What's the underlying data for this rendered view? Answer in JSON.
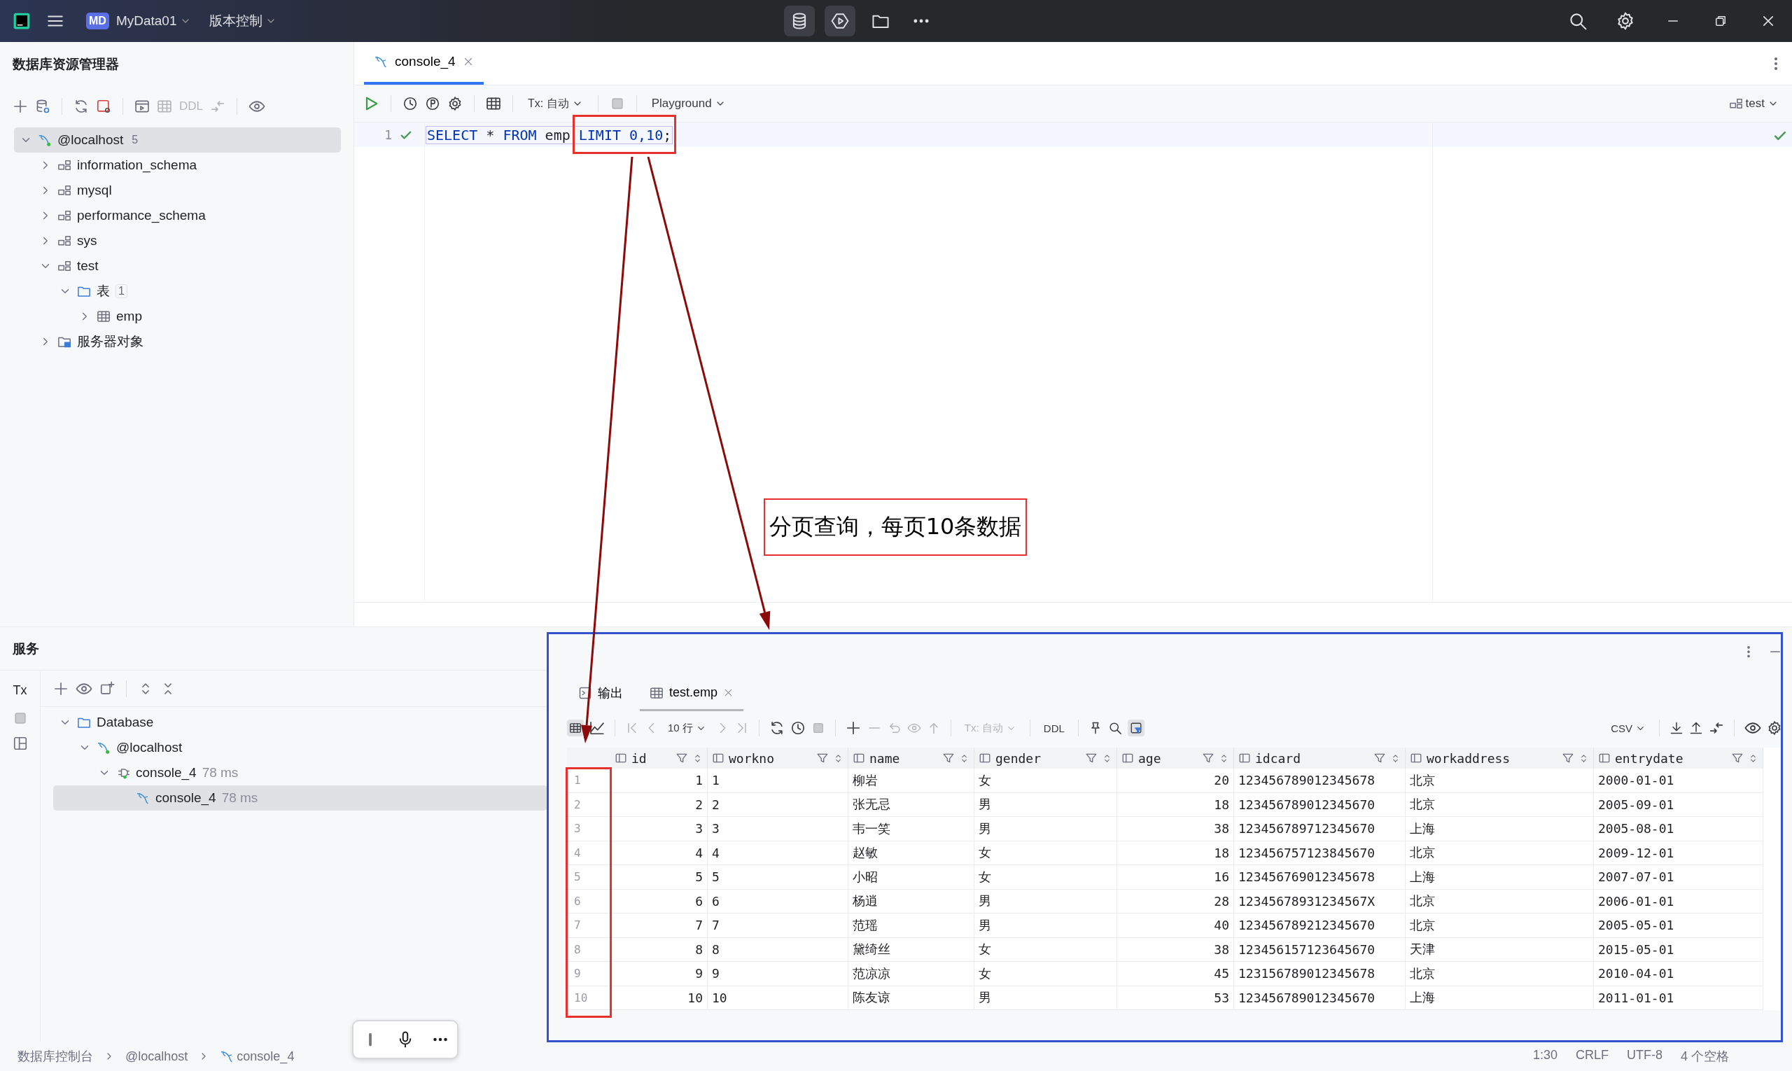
{
  "title_bar": {
    "project_badge": "MD",
    "project": "MyData01",
    "vcs_menu": "版本控制"
  },
  "explorer": {
    "title": "数据库资源管理器",
    "toolbar_label": "DDL",
    "tree": [
      {
        "label": "@localhost",
        "count": "5",
        "kind": "host",
        "expanded": true,
        "selected": true,
        "children": [
          {
            "label": "information_schema",
            "kind": "schema",
            "expanded": false,
            "selected": false
          },
          {
            "label": "mysql",
            "kind": "schema",
            "expanded": false,
            "selected": false
          },
          {
            "label": "performance_schema",
            "kind": "schema",
            "expanded": false,
            "selected": false
          },
          {
            "label": "sys",
            "kind": "schema",
            "expanded": false,
            "selected": false
          },
          {
            "label": "test",
            "kind": "schema",
            "expanded": true,
            "selected": false,
            "children": [
              {
                "label": "表",
                "count": "1",
                "kind": "folder",
                "expanded": true,
                "selected": false,
                "children": [
                  {
                    "label": "emp",
                    "kind": "table",
                    "expanded": false,
                    "selected": false
                  }
                ]
              }
            ]
          },
          {
            "label": "服务器对象",
            "kind": "server-objects",
            "expanded": false,
            "selected": false
          }
        ]
      }
    ]
  },
  "editor": {
    "tabs": [
      {
        "label": "console_4",
        "selected": true
      }
    ],
    "toolbar": {
      "transaction": "Tx: 自动",
      "mode": "Playground",
      "schema": "test"
    },
    "lines": [
      {
        "number": "1",
        "tokens": [
          {
            "text": "SELECT",
            "kind": "keyword"
          },
          {
            "text": " * ",
            "kind": "plain"
          },
          {
            "text": "FROM",
            "kind": "keyword"
          },
          {
            "text": " emp ",
            "kind": "plain"
          },
          {
            "text": "LIMIT",
            "kind": "keyword"
          },
          {
            "text": " 0,10",
            "kind": "number"
          },
          {
            "text": ";",
            "kind": "plain"
          }
        ]
      }
    ]
  },
  "services": {
    "title": "服务",
    "side_label": "Tx",
    "tree": [
      {
        "label": "Database",
        "kind": "folder",
        "expanded": true,
        "selected": false,
        "children": [
          {
            "label": "@localhost",
            "kind": "host",
            "expanded": true,
            "selected": false,
            "children": [
              {
                "label": "console_4",
                "duration": "78 ms",
                "kind": "session",
                "expanded": true,
                "selected": false,
                "children": [
                  {
                    "label": "console_4",
                    "duration": "78 ms",
                    "kind": "console",
                    "selected": true
                  }
                ]
              }
            ]
          }
        ]
      }
    ]
  },
  "results": {
    "tabs": [
      {
        "label": "输出",
        "kind": "output",
        "selected": false
      },
      {
        "label": "test.emp",
        "kind": "table",
        "selected": true
      }
    ],
    "toolbar": {
      "page_size": "10 行",
      "transaction": "Tx: 自动",
      "ddl": "DDL",
      "export_format": "CSV"
    },
    "columns": [
      {
        "name": "id",
        "kind": "number"
      },
      {
        "name": "workno",
        "kind": "text"
      },
      {
        "name": "name",
        "kind": "text"
      },
      {
        "name": "gender",
        "kind": "text"
      },
      {
        "name": "age",
        "kind": "number"
      },
      {
        "name": "idcard",
        "kind": "text"
      },
      {
        "name": "workaddress",
        "kind": "text"
      },
      {
        "name": "entrydate",
        "kind": "text"
      }
    ],
    "rows": [
      {
        "number": "1",
        "cells": [
          "1",
          "1",
          "柳岩",
          "女",
          "20",
          "123456789012345678",
          "北京",
          "2000-01-01"
        ]
      },
      {
        "number": "2",
        "cells": [
          "2",
          "2",
          "张无忌",
          "男",
          "18",
          "123456789012345670",
          "北京",
          "2005-09-01"
        ]
      },
      {
        "number": "3",
        "cells": [
          "3",
          "3",
          "韦一笑",
          "男",
          "38",
          "123456789712345670",
          "上海",
          "2005-08-01"
        ]
      },
      {
        "number": "4",
        "cells": [
          "4",
          "4",
          "赵敏",
          "女",
          "18",
          "123456757123845670",
          "北京",
          "2009-12-01"
        ]
      },
      {
        "number": "5",
        "cells": [
          "5",
          "5",
          "小昭",
          "女",
          "16",
          "123456769012345678",
          "上海",
          "2007-07-01"
        ]
      },
      {
        "number": "6",
        "cells": [
          "6",
          "6",
          "杨逍",
          "男",
          "28",
          "12345678931234567X",
          "北京",
          "2006-01-01"
        ]
      },
      {
        "number": "7",
        "cells": [
          "7",
          "7",
          "范瑶",
          "男",
          "40",
          "123456789212345670",
          "北京",
          "2005-05-01"
        ]
      },
      {
        "number": "8",
        "cells": [
          "8",
          "8",
          "黛绮丝",
          "女",
          "38",
          "123456157123645670",
          "天津",
          "2015-05-01"
        ]
      },
      {
        "number": "9",
        "cells": [
          "9",
          "9",
          "范凉凉",
          "女",
          "45",
          "123156789012345678",
          "北京",
          "2010-04-01"
        ]
      },
      {
        "number": "10",
        "cells": [
          "10",
          "10",
          "陈友谅",
          "男",
          "53",
          "123456789012345670",
          "上海",
          "2011-01-01"
        ]
      }
    ]
  },
  "annotation": {
    "callout": "分页查询，每页10条数据"
  },
  "status_bar": {
    "breadcrumbs": [
      {
        "label": "数据库控制台",
        "kind": "console"
      },
      {
        "label": "@localhost",
        "kind": "host"
      },
      {
        "label": "console_4",
        "kind": "console-file"
      }
    ],
    "items": [
      "1:30",
      "CRLF",
      "UTF-8",
      "4 个空格"
    ]
  }
}
